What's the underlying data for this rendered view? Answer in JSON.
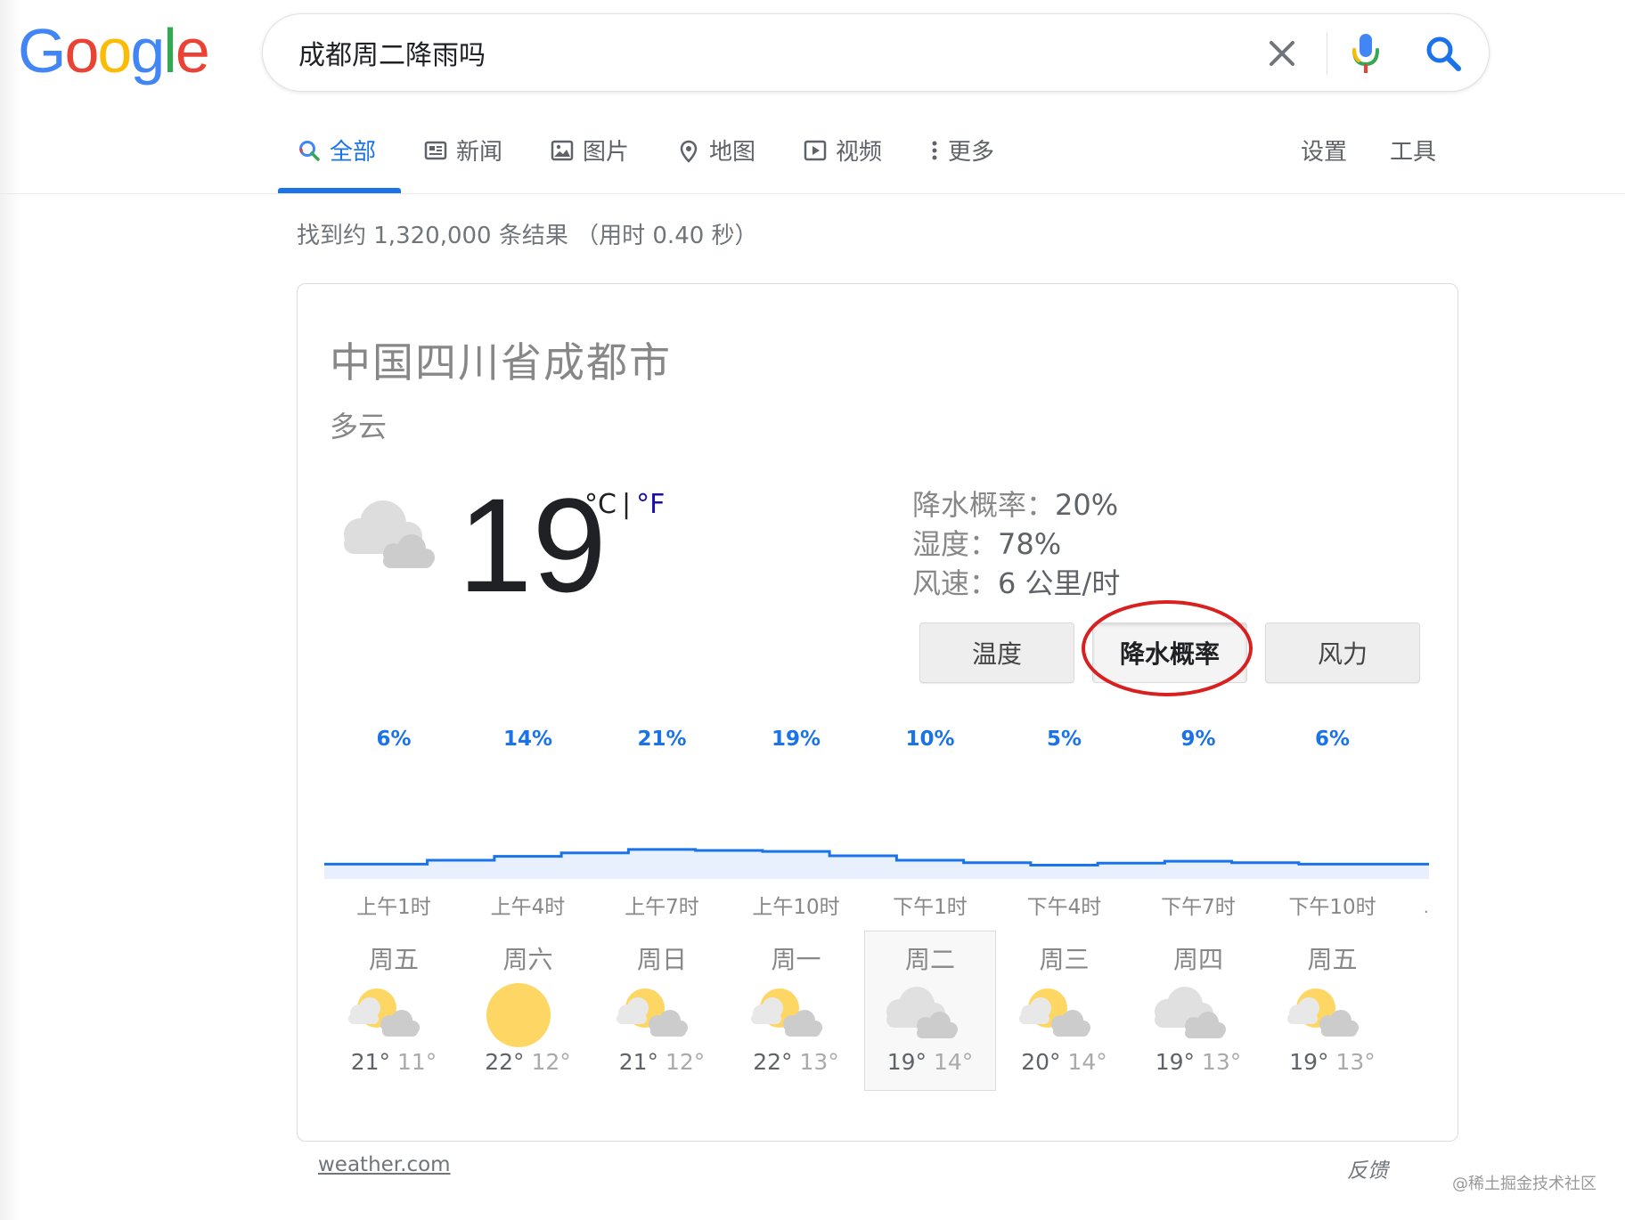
{
  "logo": {
    "letters": [
      "G",
      "o",
      "o",
      "g",
      "l",
      "e"
    ],
    "colors": [
      "#4285f4",
      "#ea4335",
      "#fbbc05",
      "#4285f4",
      "#34a853",
      "#ea4335"
    ]
  },
  "search": {
    "value": "成都周二降雨吗",
    "icons": [
      "clear-icon",
      "microphone-icon",
      "search-icon"
    ]
  },
  "tabs": {
    "all": "全部",
    "news": "新闻",
    "images": "图片",
    "maps": "地图",
    "videos": "视频",
    "more": "更多",
    "settings": "设置",
    "tools": "工具"
  },
  "result_stats": "找到约 1,320,000 条结果 （用时 0.40 秒）",
  "weather": {
    "location": "中国四川省成都市",
    "condition": "多云",
    "temperature": "19",
    "unit_c": "°C",
    "unit_sep": "|",
    "unit_f": "°F",
    "precip_label": "降水概率：",
    "precip_value": "20%",
    "humidity_label": "湿度：",
    "humidity_value": "78%",
    "wind_label": "风速：",
    "wind_value": "6 公里/时",
    "buttons": {
      "temperature": "温度",
      "precipitation": "降水概率",
      "wind": "风力"
    },
    "selected_button": "precipitation",
    "accent_color": "#1a73e8",
    "annotation_color": "#d92020"
  },
  "chart_data": {
    "type": "area",
    "x": [
      "上午1时",
      "上午4时",
      "上午7时",
      "上午10时",
      "下午1时",
      "下午4时",
      "下午7时",
      "下午10时"
    ],
    "values": [
      6,
      14,
      21,
      19,
      10,
      5,
      9,
      6
    ],
    "value_labels": [
      "6%",
      "14%",
      "21%",
      "19%",
      "10%",
      "5%",
      "9%",
      "6%"
    ],
    "unit": "%",
    "ylim": [
      0,
      100
    ]
  },
  "forecast": [
    {
      "day": "周五",
      "hi": "21°",
      "lo": "11°",
      "icon": "partly-cloudy-icon"
    },
    {
      "day": "周六",
      "hi": "22°",
      "lo": "12°",
      "icon": "sunny-icon"
    },
    {
      "day": "周日",
      "hi": "21°",
      "lo": "12°",
      "icon": "partly-cloudy-icon"
    },
    {
      "day": "周一",
      "hi": "22°",
      "lo": "13°",
      "icon": "partly-cloudy-icon"
    },
    {
      "day": "周二",
      "hi": "19°",
      "lo": "14°",
      "icon": "cloudy-icon"
    },
    {
      "day": "周三",
      "hi": "20°",
      "lo": "14°",
      "icon": "partly-cloudy-icon"
    },
    {
      "day": "周四",
      "hi": "19°",
      "lo": "13°",
      "icon": "cloudy-icon"
    },
    {
      "day": "周五",
      "hi": "19°",
      "lo": "13°",
      "icon": "partly-cloudy-icon"
    }
  ],
  "selected_day_index": 4,
  "footer": {
    "source": "weather.com",
    "feedback": "反馈",
    "watermark": "@稀土掘金技术社区"
  }
}
